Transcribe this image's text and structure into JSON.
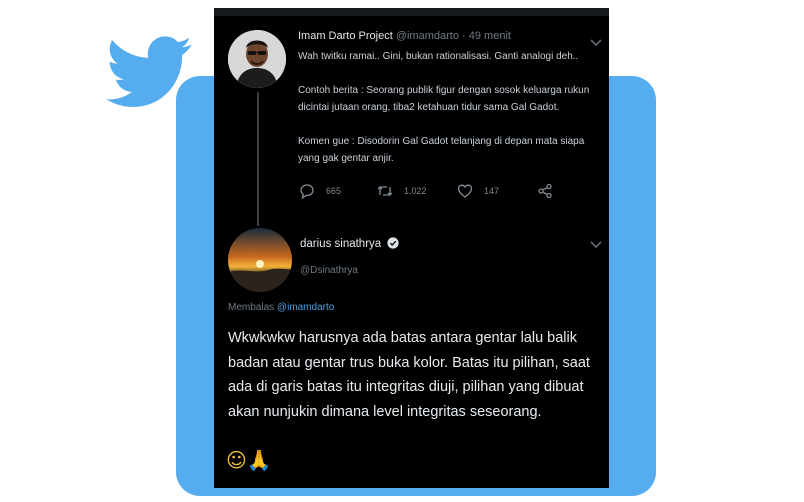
{
  "colors": {
    "twitter_blue": "#55acee",
    "panel_bg": "#000000",
    "link": "#4f9fe0"
  },
  "tweet": {
    "author_name": "Imam Darto Project",
    "handle": "@imamdarto",
    "separator": "·",
    "time": "49 menit",
    "line1": "Wah twitku ramai.. Gini, bukan rationalisasi. Ganti analogi deh..",
    "line2a": "Contoh berita : Seorang publik figur dengan sosok keluarga rukun",
    "line2b": "dicintai jutaan orang, tiba2 ketahuan tidur sama Gal Gadot.",
    "line3a": "Komen gue : Disodorin Gal Gadot telanjang di depan mata siapa",
    "line3b": "yang gak gentar anjir.",
    "stats": {
      "replies": "665",
      "retweets": "1.022",
      "likes": "147"
    },
    "icons": [
      "reply-icon",
      "retweet-icon",
      "like-icon",
      "share-icon",
      "chevron-down-icon"
    ]
  },
  "reply": {
    "author_name": "darius sinathrya",
    "handle": "@Dsinathrya",
    "replying_label": "Membalas",
    "replying_to": "@imamdarto",
    "body": "Wkwkwkw harusnya ada batas antara gentar lalu balik badan atau gentar trus buka kolor. Batas itu pilihan, saat ada di garis batas itu integritas diuji, pilihan yang dibuat akan nunjukin dimana level integritas seseorang.",
    "emojis": "☺🙏",
    "icons": [
      "verified-icon",
      "chevron-down-icon"
    ]
  }
}
